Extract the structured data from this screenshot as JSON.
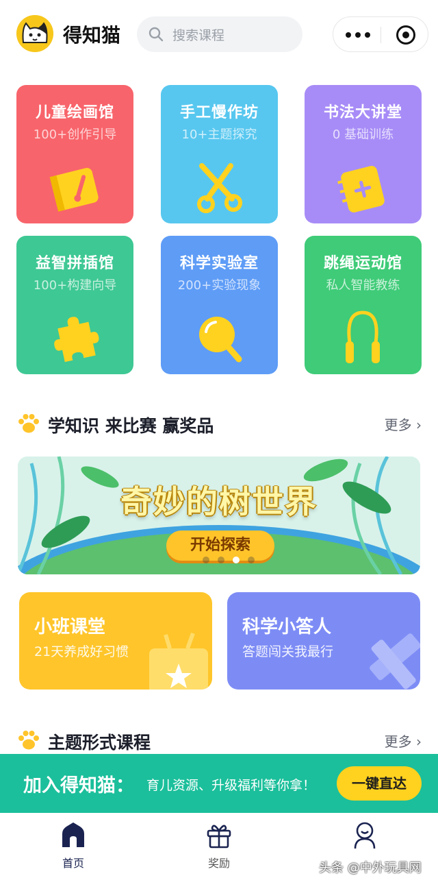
{
  "header": {
    "app_title": "得知猫",
    "search_placeholder": "搜索课程"
  },
  "categories": [
    {
      "title": "儿童绘画馆",
      "subtitle": "100+创作引导",
      "color": "#f8646b",
      "icon": "sketchbook-icon"
    },
    {
      "title": "手工慢作坊",
      "subtitle": "10+主题探究",
      "color": "#57c7ef",
      "icon": "scissors-icon"
    },
    {
      "title": "书法大讲堂",
      "subtitle": "0 基础训练",
      "color": "#a78cf7",
      "icon": "notebook-icon"
    },
    {
      "title": "益智拼插馆",
      "subtitle": "100+构建向导",
      "color": "#3ec894",
      "icon": "puzzle-icon"
    },
    {
      "title": "科学实验室",
      "subtitle": "200+实验现象",
      "color": "#5e9cf6",
      "icon": "magnifier-icon"
    },
    {
      "title": "跳绳运动馆",
      "subtitle": "私人智能教练",
      "color": "#3fcb78",
      "icon": "jump-rope-icon"
    }
  ],
  "section_learn": {
    "title": "学知识 来比赛 赢奖品",
    "more": "更多"
  },
  "banner": {
    "title": "奇妙的树世界",
    "button": "开始探索",
    "slides": 4,
    "active_slide": 3
  },
  "promos": [
    {
      "title": "小班课堂",
      "subtitle": "21天养成好习惯",
      "color": "#ffc52a"
    },
    {
      "title": "科学小答人",
      "subtitle": "答题闯关我最行",
      "color": "#7d8cf5"
    }
  ],
  "section_topics": {
    "title": "主题形式课程",
    "more": "更多"
  },
  "join_bar": {
    "title": "加入得知猫：",
    "subtitle": "育儿资源、升级福利等你拿！",
    "button": "一键直达"
  },
  "tabs": [
    {
      "label": "首页",
      "icon": "home-icon",
      "active": true
    },
    {
      "label": "奖励",
      "icon": "gift-icon",
      "active": false
    },
    {
      "label": "",
      "icon": "profile-icon",
      "active": false
    }
  ],
  "watermark": "头条 @中外玩具网"
}
